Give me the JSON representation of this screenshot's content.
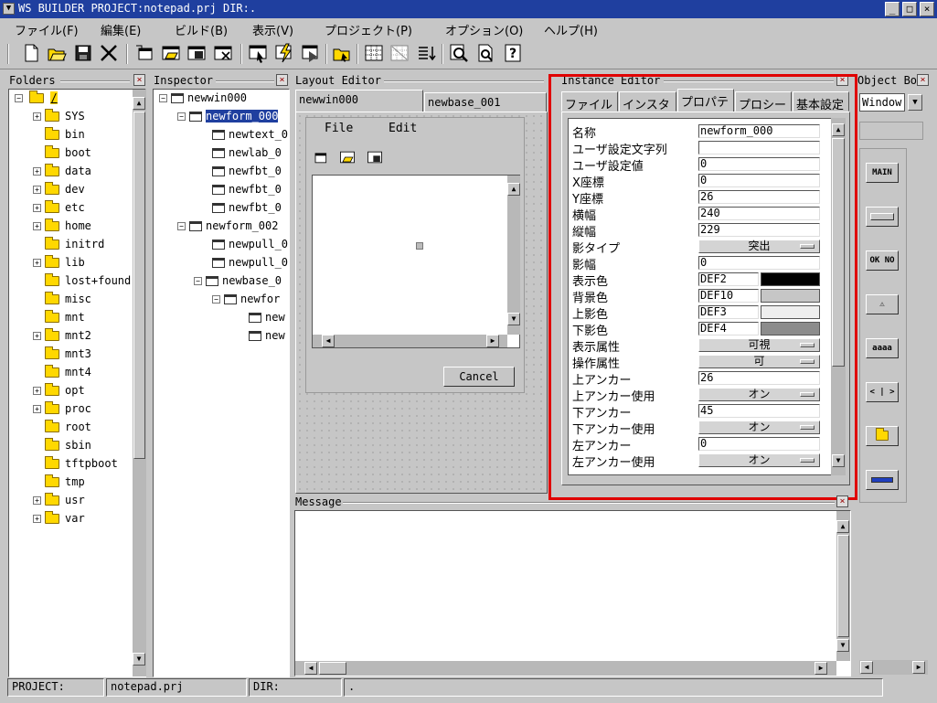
{
  "window": {
    "title": "WS BUILDER PROJECT:notepad.prj DIR:."
  },
  "menubar": [
    "ファイル(F)",
    "編集(E)",
    "ビルド(B)",
    "表示(V)",
    "プロジェクト(P)",
    "オプション(O)",
    "ヘルプ(H)"
  ],
  "folders": {
    "title": "Folders",
    "root": "/",
    "items": [
      "SYS",
      "bin",
      "boot",
      "data",
      "dev",
      "etc",
      "home",
      "initrd",
      "lib",
      "lost+found",
      "misc",
      "mnt",
      "mnt2",
      "mnt3",
      "mnt4",
      "opt",
      "proc",
      "root",
      "sbin",
      "tftpboot",
      "tmp",
      "usr",
      "var"
    ]
  },
  "inspector": {
    "title": "Inspector",
    "nodes": [
      "newwin000",
      "newform_000",
      "newtext_0",
      "newlab_0",
      "newfbt_0",
      "newfbt_0",
      "newfbt_0",
      "newform_002",
      "newpull_0",
      "newpull_0",
      "newbase_0",
      "newfor",
      "new",
      "new"
    ]
  },
  "layout_editor": {
    "title": "Layout Editor",
    "tabs": [
      "newwin000",
      "newbase_001"
    ],
    "preview_menu": [
      "File",
      "Edit"
    ],
    "cancel_label": "Cancel"
  },
  "instance_editor": {
    "title": "Instance Editor",
    "tabs": [
      "ファイル",
      "インスタ",
      "プロパテ",
      "プロシー",
      "基本設定"
    ],
    "props": [
      {
        "label": "名称",
        "value": "newform_000"
      },
      {
        "label": "ユーザ設定文字列",
        "value": ""
      },
      {
        "label": "ユーザ設定値",
        "value": "0"
      },
      {
        "label": "X座標",
        "value": "0"
      },
      {
        "label": "Y座標",
        "value": "26"
      },
      {
        "label": "横幅",
        "value": "240"
      },
      {
        "label": "縦幅",
        "value": "229"
      },
      {
        "label": "影タイプ",
        "value": "突出"
      },
      {
        "label": "影幅",
        "value": "0"
      },
      {
        "label": "表示色",
        "value": "DEF2",
        "color": "#000000"
      },
      {
        "label": "背景色",
        "value": "DEF10",
        "color": "#c6c6c6"
      },
      {
        "label": "上影色",
        "value": "DEF3",
        "color": "#eeeeee"
      },
      {
        "label": "下影色",
        "value": "DEF4",
        "color": "#8c8c8c"
      },
      {
        "label": "表示属性",
        "value": "可視"
      },
      {
        "label": "操作属性",
        "value": "可"
      },
      {
        "label": "上アンカー",
        "value": "26"
      },
      {
        "label": "上アンカー使用",
        "value": "オン"
      },
      {
        "label": "下アンカー",
        "value": "45"
      },
      {
        "label": "下アンカー使用",
        "value": "オン"
      },
      {
        "label": "左アンカー",
        "value": "0"
      },
      {
        "label": "左アンカー使用",
        "value": "オン"
      }
    ]
  },
  "message": {
    "title": "Message"
  },
  "object_box": {
    "title": "Object Bo",
    "selected": "Window",
    "buttons": [
      "MAIN",
      "",
      "OK NO",
      "⚠",
      "aaaa",
      "< | >",
      "",
      ""
    ]
  },
  "status": {
    "project_label": "PROJECT:",
    "project_value": "notepad.prj",
    "dir_label": "DIR:",
    "dir_value": "."
  }
}
